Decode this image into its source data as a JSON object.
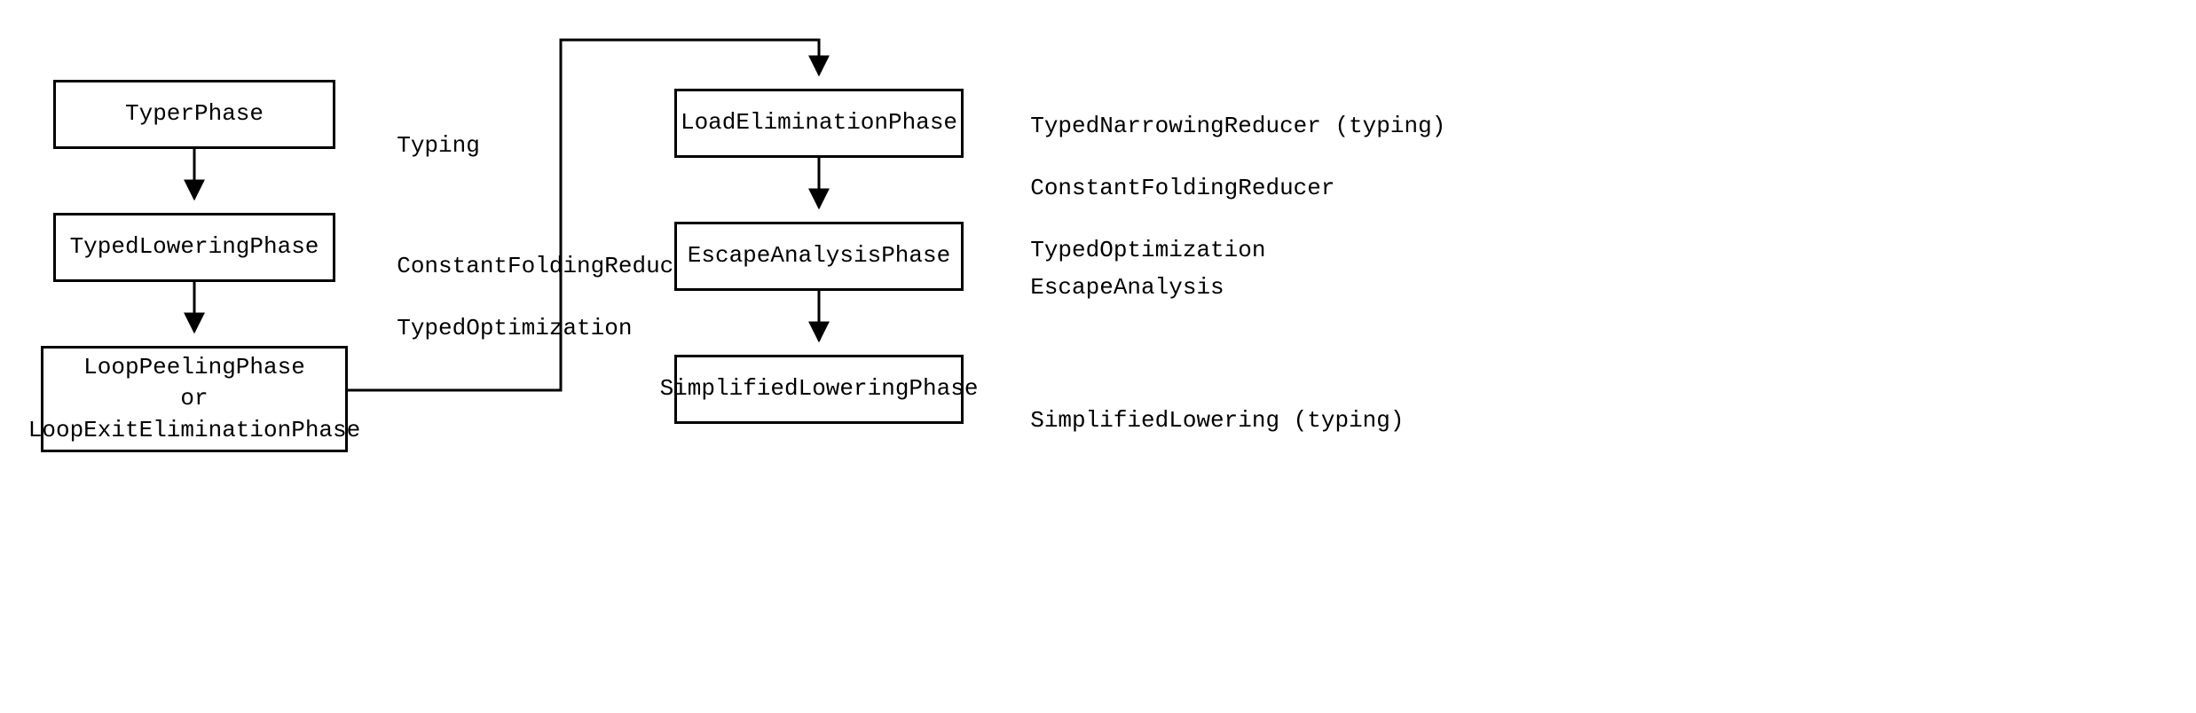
{
  "chart_data": {
    "type": "flowchart",
    "nodes": [
      {
        "id": "typer",
        "label": "TyperPhase",
        "annotations": [
          "Typing"
        ]
      },
      {
        "id": "typedlow",
        "label": "TypedLoweringPhase",
        "annotations": [
          "ConstantFoldingReducer",
          "TypedOptimization"
        ]
      },
      {
        "id": "loop",
        "label": "LoopPeelingPhase\nor\nLoopExitEliminationPhase",
        "annotations": []
      },
      {
        "id": "loadelim",
        "label": "LoadEliminationPhase",
        "annotations": [
          "TypedNarrowingReducer (typing)",
          "ConstantFoldingReducer",
          "TypedOptimization"
        ]
      },
      {
        "id": "escape",
        "label": "EscapeAnalysisPhase",
        "annotations": [
          "EscapeAnalysis"
        ]
      },
      {
        "id": "simplow",
        "label": "SimplifiedLoweringPhase",
        "annotations": [
          "SimplifiedLowering (typing)"
        ]
      }
    ],
    "edges": [
      [
        "typer",
        "typedlow"
      ],
      [
        "typedlow",
        "loop"
      ],
      [
        "loop",
        "loadelim"
      ],
      [
        "loadelim",
        "escape"
      ],
      [
        "escape",
        "simplow"
      ]
    ]
  },
  "nodes": {
    "typer": {
      "line1": "TyperPhase"
    },
    "typedlow": {
      "line1": "TypedLoweringPhase"
    },
    "loop": {
      "line1": "LoopPeelingPhase",
      "line2": "or",
      "line3": "LoopExitEliminationPhase"
    },
    "loadelim": {
      "line1": "LoadEliminationPhase"
    },
    "escape": {
      "line1": "EscapeAnalysisPhase"
    },
    "simplow": {
      "line1": "SimplifiedLoweringPhase"
    }
  },
  "annots": {
    "typer": {
      "line1": "Typing"
    },
    "typedlow": {
      "line1": "ConstantFoldingReducer",
      "line2": "TypedOptimization"
    },
    "loadelim": {
      "line1": "TypedNarrowingReducer (typing)",
      "line2": "ConstantFoldingReducer",
      "line3": "TypedOptimization"
    },
    "escape": {
      "line1": "EscapeAnalysis"
    },
    "simplow": {
      "line1": "SimplifiedLowering (typing)"
    }
  }
}
